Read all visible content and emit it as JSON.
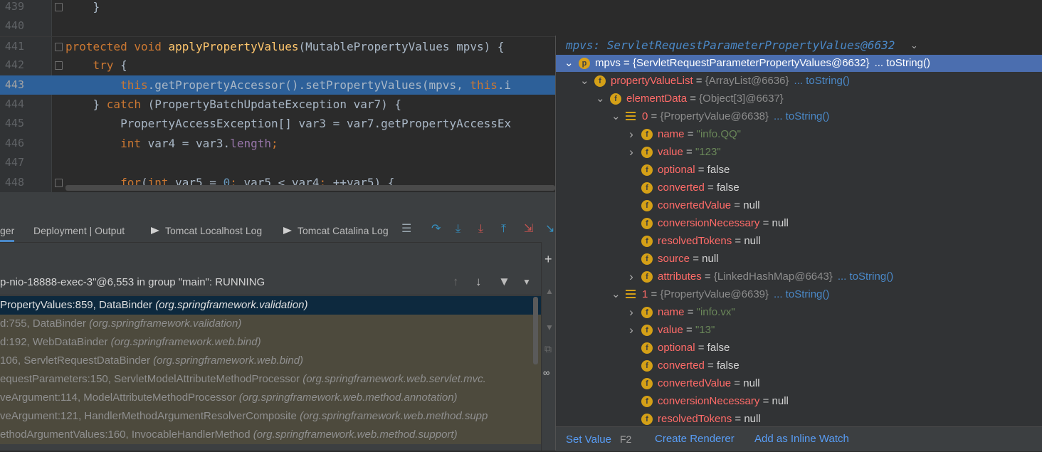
{
  "editor": {
    "lines": [
      {
        "num": "439",
        "code": [
          {
            "t": "    }",
            "c": ""
          }
        ]
      },
      {
        "num": "440",
        "code": []
      },
      {
        "num": "441",
        "code": [
          {
            "t": "protected void ",
            "c": "kw"
          },
          {
            "t": "applyPropertyValues",
            "c": "fn"
          },
          {
            "t": "(MutablePropertyValues mpvs) {",
            "c": ""
          }
        ]
      },
      {
        "num": "442",
        "code": [
          {
            "t": "    try ",
            "c": "kw"
          },
          {
            "t": "{",
            "c": ""
          }
        ]
      },
      {
        "num": "443",
        "code": [
          {
            "t": "        this",
            "c": "kw"
          },
          {
            "t": ".getPropertyAccessor().setPropertyValues(mpvs, ",
            "c": ""
          },
          {
            "t": "this",
            "c": "kw"
          },
          {
            "t": ".i",
            "c": ""
          }
        ]
      },
      {
        "num": "444",
        "code": [
          {
            "t": "    } ",
            "c": ""
          },
          {
            "t": "catch ",
            "c": "kw"
          },
          {
            "t": "(PropertyBatchUpdateException var7) {",
            "c": ""
          }
        ]
      },
      {
        "num": "445",
        "code": [
          {
            "t": "        PropertyAccessException[] var3 = var7.getPropertyAccessEx",
            "c": ""
          }
        ]
      },
      {
        "num": "446",
        "code": [
          {
            "t": "        int ",
            "c": "kw"
          },
          {
            "t": "var4 = var3.",
            "c": ""
          },
          {
            "t": "length",
            "c": "pink"
          },
          {
            "t": ";",
            "c": "kw"
          }
        ]
      },
      {
        "num": "447",
        "code": []
      },
      {
        "num": "448",
        "code": [
          {
            "t": "        for",
            "c": "kw"
          },
          {
            "t": "(",
            "c": ""
          },
          {
            "t": "int ",
            "c": "kw"
          },
          {
            "t": "var5",
            "c": "ul"
          },
          {
            "t": " = ",
            "c": ""
          },
          {
            "t": "0",
            "c": "num"
          },
          {
            "t": "; ",
            "c": "kw"
          },
          {
            "t": "var5",
            "c": "ul"
          },
          {
            "t": " < var4",
            "c": ""
          },
          {
            "t": "; ",
            "c": "kw"
          },
          {
            "t": "++",
            "c": ""
          },
          {
            "t": "var5",
            "c": "ul"
          },
          {
            "t": ") {",
            "c": ""
          }
        ]
      }
    ]
  },
  "debug": {
    "tabs": {
      "debugger": "ger",
      "deployment": "Deployment | Output",
      "localhost_log": "Tomcat Localhost Log",
      "catalina_log": "Tomcat Catalina Log"
    },
    "thread_label": "p-nio-18888-exec-3\"@6,553 in group \"main\": RUNNING",
    "frames": [
      {
        "method": "PropertyValues:859, DataBinder ",
        "pkg": "(org.springframework.validation)"
      },
      {
        "method": "d:755, DataBinder ",
        "pkg": "(org.springframework.validation)"
      },
      {
        "method": "d:192, WebDataBinder ",
        "pkg": "(org.springframework.web.bind)"
      },
      {
        "method": "106, ServletRequestDataBinder ",
        "pkg": "(org.springframework.web.bind)"
      },
      {
        "method": "equestParameters:150, ServletModelAttributeMethodProcessor ",
        "pkg": "(org.springframework.web.servlet.mvc."
      },
      {
        "method": "veArgument:114, ModelAttributeMethodProcessor ",
        "pkg": "(org.springframework.web.method.annotation)"
      },
      {
        "method": "veArgument:121, HandlerMethodArgumentResolverComposite ",
        "pkg": "(org.springframework.web.method.supp"
      },
      {
        "method": "ethodArgumentValues:160, InvocableHandlerMethod ",
        "pkg": "(org.springframework.web.method.support)"
      }
    ]
  },
  "popup": {
    "title": "mpvs: ServletRequestParameterPropertyValues@6632",
    "tree": [
      {
        "depth": 0,
        "arrow": "down",
        "icon": "p",
        "name": "mpvs",
        "eq": " = ",
        "value": "{ServletRequestParameterPropertyValues@6632}",
        "vtype": "obj",
        "link": "... toString()",
        "selected": true
      },
      {
        "depth": 1,
        "arrow": "down",
        "icon": "f",
        "name": "propertyValueList",
        "eq": " = ",
        "value": "{ArrayList@6636}",
        "vtype": "obj",
        "link": "... toString()"
      },
      {
        "depth": 2,
        "arrow": "down",
        "icon": "f",
        "name": "elementData",
        "eq": " = ",
        "value": "{Object[3]@6637}",
        "vtype": "obj",
        "link": ""
      },
      {
        "depth": 3,
        "arrow": "down",
        "icon": "arr",
        "name": "0",
        "eq": " = ",
        "value": "{PropertyValue@6638}",
        "vtype": "obj",
        "link": "... toString()"
      },
      {
        "depth": 4,
        "arrow": "right",
        "icon": "f",
        "name": "name",
        "eq": " = ",
        "value": "\"info.QQ\"",
        "vtype": "str",
        "link": ""
      },
      {
        "depth": 4,
        "arrow": "right",
        "icon": "f",
        "name": "value",
        "eq": " = ",
        "value": "\"123\"",
        "vtype": "str",
        "link": ""
      },
      {
        "depth": 4,
        "arrow": "",
        "icon": "f",
        "name": "optional",
        "eq": " = ",
        "value": "false",
        "vtype": "plain",
        "link": ""
      },
      {
        "depth": 4,
        "arrow": "",
        "icon": "f",
        "name": "converted",
        "eq": " = ",
        "value": "false",
        "vtype": "plain",
        "link": ""
      },
      {
        "depth": 4,
        "arrow": "",
        "icon": "f",
        "name": "convertedValue",
        "eq": " = ",
        "value": "null",
        "vtype": "plain",
        "link": ""
      },
      {
        "depth": 4,
        "arrow": "",
        "icon": "f",
        "name": "conversionNecessary",
        "eq": " = ",
        "value": "null",
        "vtype": "plain",
        "link": ""
      },
      {
        "depth": 4,
        "arrow": "",
        "icon": "f",
        "name": "resolvedTokens",
        "eq": " = ",
        "value": "null",
        "vtype": "plain",
        "link": ""
      },
      {
        "depth": 4,
        "arrow": "",
        "icon": "f",
        "name": "source",
        "eq": " = ",
        "value": "null",
        "vtype": "plain",
        "link": ""
      },
      {
        "depth": 4,
        "arrow": "right",
        "icon": "f",
        "name": "attributes",
        "eq": " = ",
        "value": "{LinkedHashMap@6643}",
        "vtype": "obj",
        "link": "... toString()"
      },
      {
        "depth": 3,
        "arrow": "down",
        "icon": "arr",
        "name": "1",
        "eq": " = ",
        "value": "{PropertyValue@6639}",
        "vtype": "obj",
        "link": "... toString()"
      },
      {
        "depth": 4,
        "arrow": "right",
        "icon": "f",
        "name": "name",
        "eq": " = ",
        "value": "\"info.vx\"",
        "vtype": "str",
        "link": ""
      },
      {
        "depth": 4,
        "arrow": "right",
        "icon": "f",
        "name": "value",
        "eq": " = ",
        "value": "\"13\"",
        "vtype": "str",
        "link": ""
      },
      {
        "depth": 4,
        "arrow": "",
        "icon": "f",
        "name": "optional",
        "eq": " = ",
        "value": "false",
        "vtype": "plain",
        "link": ""
      },
      {
        "depth": 4,
        "arrow": "",
        "icon": "f",
        "name": "converted",
        "eq": " = ",
        "value": "false",
        "vtype": "plain",
        "link": ""
      },
      {
        "depth": 4,
        "arrow": "",
        "icon": "f",
        "name": "convertedValue",
        "eq": " = ",
        "value": "null",
        "vtype": "plain",
        "link": ""
      },
      {
        "depth": 4,
        "arrow": "",
        "icon": "f",
        "name": "conversionNecessary",
        "eq": " = ",
        "value": "null",
        "vtype": "plain",
        "link": ""
      },
      {
        "depth": 4,
        "arrow": "",
        "icon": "f",
        "name": "resolvedTokens",
        "eq": " = ",
        "value": "null",
        "vtype": "plain",
        "link": ""
      }
    ],
    "footer": {
      "set_value": "Set Value",
      "set_value_key": "F2",
      "create_renderer": "Create Renderer",
      "add_inline_watch": "Add as Inline Watch"
    }
  },
  "colors": {
    "accent": "#4a88c7",
    "selection": "#4b6eaf",
    "keyword": "#cc7832",
    "function": "#ffc66d",
    "string": "#6a8759",
    "field": "#ff6b68"
  }
}
